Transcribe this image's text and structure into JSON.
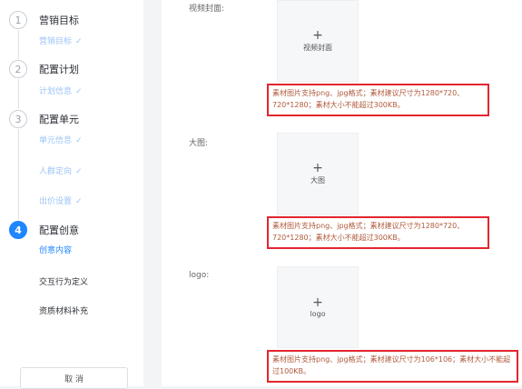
{
  "sidebar": {
    "steps": [
      {
        "number": "1",
        "title": "营销目标",
        "substeps": [
          {
            "label": "营销目标",
            "check": "✓"
          }
        ]
      },
      {
        "number": "2",
        "title": "配置计划",
        "substeps": [
          {
            "label": "计划信息",
            "check": "✓"
          }
        ]
      },
      {
        "number": "3",
        "title": "配置单元",
        "substeps": [
          {
            "label": "单元信息",
            "check": "✓"
          },
          {
            "label": "人群定向",
            "check": "✓"
          },
          {
            "label": "出价设置",
            "check": "✓"
          }
        ]
      },
      {
        "number": "4",
        "title": "配置创意",
        "substeps": [
          {
            "label": "创意内容"
          },
          {
            "label": "交互行为定义"
          },
          {
            "label": "资质材料补充"
          }
        ]
      }
    ],
    "cancel_label": "取 消"
  },
  "form": {
    "fields": [
      {
        "label": "视频封面:",
        "upload_plus": "+",
        "upload_label": "视频封面",
        "hint": "素材图片支持png、jpg格式；素材建议尺寸为1280*720、720*1280；素材大小不能超过300KB。"
      },
      {
        "label": "大图:",
        "upload_plus": "+",
        "upload_label": "大图",
        "hint": "素材图片支持png、jpg格式；素材建议尺寸为1280*720、720*1280；素材大小不能超过300KB。"
      },
      {
        "label": "logo:",
        "upload_plus": "+",
        "upload_label": "logo",
        "hint": "素材图片支持png、jpg格式；素材建议尺寸为106*106；素材大小不能超过100KB。"
      }
    ]
  },
  "colors": {
    "accent": "#1f86ff",
    "highlight": "#e3262f"
  }
}
